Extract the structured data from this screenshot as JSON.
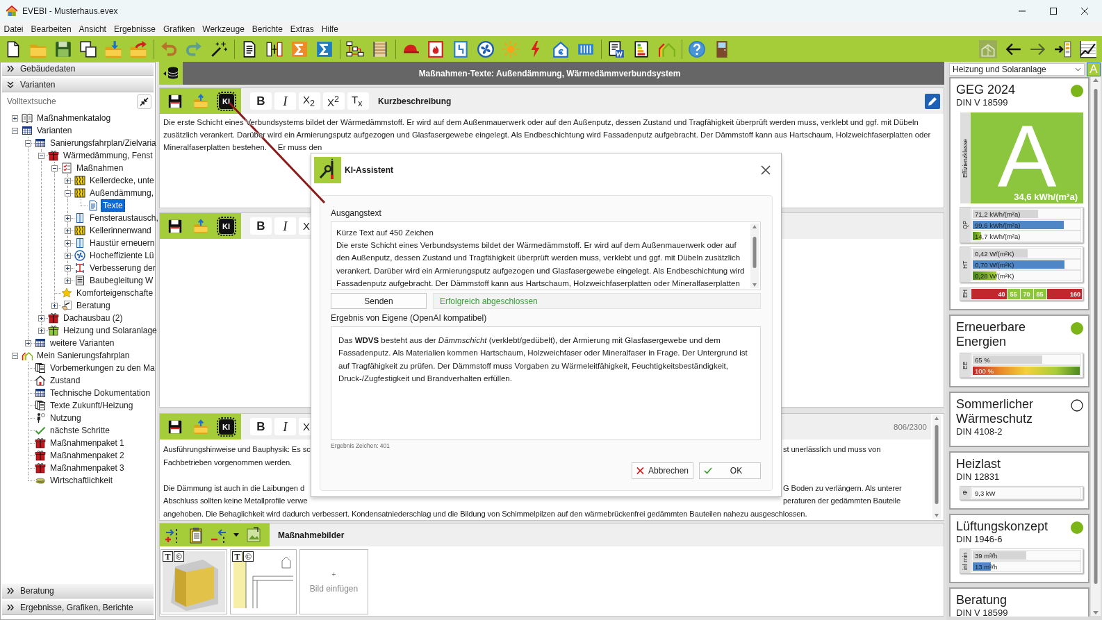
{
  "window": {
    "title": "EVEBI - Musterhaus.evex"
  },
  "menu": [
    "Datei",
    "Bearbeiten",
    "Ansicht",
    "Ergebnisse",
    "Grafiken",
    "Werkzeuge",
    "Berichte",
    "Extras",
    "Hilfe"
  ],
  "sidebar": {
    "sections_top": [
      {
        "label": "Gebäudedaten",
        "expanded": false
      },
      {
        "label": "Varianten",
        "expanded": true
      }
    ],
    "search": {
      "placeholder": "Volltextsuche"
    },
    "tree": [
      {
        "label": "Maßnahmenkatalog",
        "kind": "catalog",
        "expanded": false,
        "selected": false
      },
      {
        "label": "Varianten",
        "kind": "table",
        "expanded": true,
        "selected": false,
        "children": [
          {
            "label": "Sanierungsfahrplan/Zielvaria",
            "kind": "table",
            "expanded": true,
            "selected": false,
            "children": [
              {
                "label": "Wärmedämmung, Fenst",
                "kind": "package",
                "color": "#c8141c",
                "expanded": true,
                "selected": false,
                "children": [
                  {
                    "label": "Maßnahmen",
                    "kind": "measures",
                    "expanded": true,
                    "selected": false,
                    "children": [
                      {
                        "label": "Kellerdecke, unte",
                        "kind": "insulation",
                        "expanded": false,
                        "selected": false
                      },
                      {
                        "label": "Außendämmung,",
                        "kind": "insulation",
                        "expanded": true,
                        "selected": false,
                        "children": [
                          {
                            "label": "Texte",
                            "kind": "text",
                            "selected": true
                          }
                        ]
                      },
                      {
                        "label": "Fensteraustausch,",
                        "kind": "window",
                        "expanded": false,
                        "selected": false
                      },
                      {
                        "label": "Kellerinnenwand",
                        "kind": "insulation",
                        "expanded": false,
                        "selected": false
                      },
                      {
                        "label": "Haustür erneuern",
                        "kind": "window",
                        "expanded": false,
                        "selected": false
                      },
                      {
                        "label": "Hocheffiziente Lü",
                        "kind": "ventilation",
                        "expanded": false,
                        "selected": false
                      },
                      {
                        "label": "Verbesserung der",
                        "kind": "piping",
                        "expanded": false,
                        "selected": false
                      },
                      {
                        "label": "Baubegleitung W",
                        "kind": "supervision",
                        "expanded": false,
                        "selected": false
                      }
                    ]
                  },
                  {
                    "label": "Komforteigenschafte",
                    "kind": "comfort",
                    "selected": false
                  },
                  {
                    "label": "Beratung",
                    "kind": "consulting",
                    "expanded": false,
                    "selected": false
                  }
                ]
              },
              {
                "label": "Dachausbau (2)",
                "kind": "package",
                "color": "#c8141c",
                "expanded": false,
                "selected": false
              },
              {
                "label": "Heizung und Solaranlage",
                "kind": "package",
                "color": "#8dc63f",
                "expanded": false,
                "selected": false
              }
            ]
          },
          {
            "label": "weitere Varianten",
            "kind": "table",
            "expanded": false,
            "selected": false
          }
        ]
      },
      {
        "label": "Mein Sanierungsfahrplan",
        "kind": "plan",
        "expanded": true,
        "selected": false,
        "children": [
          {
            "label": "Vorbemerkungen zu den Ma",
            "kind": "pages",
            "selected": false
          },
          {
            "label": "Zustand",
            "kind": "house",
            "selected": false
          },
          {
            "label": "Technische Dokumentation",
            "kind": "table",
            "selected": false
          },
          {
            "label": "Texte Zukunft/Heizung",
            "kind": "pages",
            "selected": false
          },
          {
            "label": "Nutzung",
            "kind": "usage",
            "selected": false
          },
          {
            "label": "nächste Schritte",
            "kind": "steps",
            "selected": false
          },
          {
            "label": "Maßnahmenpaket 1",
            "kind": "package",
            "color": "#c8141c",
            "selected": false
          },
          {
            "label": "Maßnahmenpaket 2",
            "kind": "package",
            "color": "#c8141c",
            "selected": false
          },
          {
            "label": "Maßnahmenpaket 3",
            "kind": "package",
            "color": "#c8141c",
            "selected": false
          },
          {
            "label": "Wirtschaftlichkeit",
            "kind": "economics",
            "selected": false
          }
        ]
      }
    ],
    "sections_bottom": [
      {
        "label": "Beratung",
        "expanded": false
      },
      {
        "label": "Ergebnisse, Grafiken, Berichte",
        "expanded": false
      }
    ]
  },
  "content": {
    "title": "Maßnahmen-Texte: Außendämmung, Wärmedämmverbundsystem",
    "editors": [
      {
        "ki_label": "KI",
        "format_buttons": [
          {
            "label": "B",
            "kind": "bold"
          },
          {
            "label": "I",
            "kind": "italic"
          },
          {
            "label": "X$_{2}$",
            "kind": "subscript"
          },
          {
            "label": "X$^{2}$",
            "kind": "superscript"
          },
          {
            "label": "T$_{x}$",
            "kind": "clear"
          }
        ],
        "label": "Kurzbeschreibung",
        "lines": [
          {
            "text": "Die erste Schicht eines Verbundsystems bildet der Wärmedämmstoff. Er wird auf dem Außenmauerwerk oder auf den Außenputz, dessen Zustand und Tragfähigkeit überprüft werden muss, verklebt und ggf. mit Dübeln"
          },
          {
            "text": "zusätzlich verankert. Darüber wird ein Armierungsputz aufgezogen und Glasfasergewebe eingelegt. Als Endbeschichtung wird Fassadenputz aufgebracht. Der Dämmstoff kann aus Hartschaum, Holzweichfaserplatten oder"
          },
          {
            "text": "Mineralfaserplatten bestehen.",
            "tail": "Er muss den"
          }
        ]
      },
      {
        "ki_label": "KI",
        "format_buttons": [
          {
            "label": "B",
            "kind": "bold"
          },
          {
            "label": "I",
            "kind": "italic"
          },
          {
            "label": "X",
            "kind": "subscript"
          }
        ]
      },
      {
        "ki_label": "KI",
        "format_buttons": [
          {
            "label": "B",
            "kind": "bold"
          },
          {
            "label": "I",
            "kind": "italic"
          },
          {
            "label": "X",
            "kind": "subscript"
          }
        ],
        "counter": "806/2300",
        "paragraphs": [
          {
            "lines": [
              {
                "left": "Ausführungshinweise und Bauphysik: Es sc",
                "right": "st unerlässlich und muss von"
              },
              {
                "left": "Fachbetrieben vorgenommen werden."
              }
            ]
          },
          {
            "lines": [
              {
                "left": "Die Dämmung ist auch in die Laibungen d",
                "right": "G Boden zu verlängern. Als unterer"
              },
              {
                "left": "Abschluss sollten keine Metallprofile verwe",
                "right": "peraturen der gedämmten Bauteile"
              },
              {
                "left": "angehoben. Die Behaglichkeit wird dadurch verbessert. Kondensatniederschlag und die Bildung von Schimmelpilzen auf den wärmebrückenfrei gedämmten Bauteilen nahezu ausgeschlossen."
              }
            ]
          }
        ]
      }
    ],
    "images": {
      "label": "Maßnahmebilder",
      "thumbnails": [
        {
          "kind": "photo",
          "badges": [
            "T",
            "©"
          ]
        },
        {
          "kind": "drawing",
          "badges": [
            "T",
            "©"
          ]
        }
      ],
      "add_tile": {
        "plus": "+",
        "label": "Bild einfügen"
      }
    }
  },
  "dialog": {
    "title": "KI-Assistent",
    "source_label": "Ausgangstext",
    "source_text": "Kürze Text auf 450 Zeichen\nDie erste Schicht eines Verbundsystems bildet der Wärmedämmstoff. Er wird auf dem Außenmauerwerk oder auf den Außenputz, dessen Zustand und Tragfähigkeit überprüft werden muss, verklebt und ggf. mit Dübeln zusätzlich verankert. Darüber wird ein Armierungsputz aufgezogen und Glasfasergewebe eingelegt. Als Endbeschichtung wird Fassadenputz aufgebracht. Der Dämmstoff kann aus Hartschaum, Holzweichfaserplatten oder Mineralfaserplatten",
    "send_button": "Senden",
    "status": "Erfolgreich abgeschlossen",
    "succeeded": true,
    "result_label": "Ergebnis von Eigene (OpenAI kompatibel)",
    "result_text": "Das **WDVS** besteht aus der *Dämmschicht* (verklebt/gedübelt), der Armierung mit Glasfasergewebe und dem Fassadenputz. Als Materialien kommen Hartschaum, Holzweichfaser oder Mineralfaser in Frage. Der Untergrund ist auf Tragfähigkeit zu prüfen. Der Dämmstoff muss Vorgaben zu Wärmeleitfähigkeit, Feuchtigkeitsbeständigkeit, Druck-/Zugfestigkeit und Brandverhalten erfüllen.",
    "result_count": "Ergebnis Zeichen: 401",
    "buttons": [
      {
        "label": "Abbrechen",
        "kind": "cancel"
      },
      {
        "label": "OK",
        "kind": "confirm"
      }
    ]
  },
  "right_panel": {
    "variant_select": "Heizung und Solaranlage",
    "class_button": "A",
    "cards": [
      {
        "title": "GEG 2024",
        "subtitle": "DIN V 18599",
        "fulfilled": true,
        "efficiency": {
          "axis": "Effizienzklasse",
          "letter": "A",
          "value": "34,6 kWh/(m²a)"
        },
        "groups": [
          {
            "axis": "QP",
            "bars": [
              {
                "text": "71,2 kWh/(m²a)",
                "kind": "reference",
                "level": 0.61
              },
              {
                "text": "99,6 kWh/(m²a)",
                "kind": "requirement",
                "level": 0.85
              },
              {
                "text": "14,7 kWh/(m²a)",
                "kind": "result",
                "level": 0.08
              }
            ]
          },
          {
            "axis": "HT",
            "bars": [
              {
                "text": "0,42 W/(m²K)",
                "kind": "reference",
                "level": 0.51
              },
              {
                "text": "0,70 W/(m²K)",
                "kind": "requirement",
                "level": 0.86
              },
              {
                "text": "0,28 W/(m²K)",
                "kind": "result",
                "level": 0.22
              }
            ]
          }
        ],
        "scale": {
          "axis": "EH",
          "segments": [
            {
              "label": "40",
              "color": "#c0282d"
            },
            {
              "label": "55",
              "color": "#8cc63f"
            },
            {
              "label": "70",
              "color": "#8cc63f"
            },
            {
              "label": "85",
              "color": "#8cc63f"
            },
            {
              "label": "160",
              "color": "#c0282d"
            }
          ]
        }
      },
      {
        "title": "Erneuerbare Energien",
        "fulfilled": true,
        "groups": [
          {
            "axis": "EE",
            "bars": [
              {
                "text": "65 %",
                "kind": "reference",
                "level": 0.65
              },
              {
                "text": "100 %",
                "kind": "rating",
                "level": 1
              }
            ]
          }
        ]
      },
      {
        "title": "Sommerlicher Wärmeschutz",
        "subtitle": "DIN 4108-2",
        "fulfilled": false
      },
      {
        "title": "Heizlast",
        "subtitle": "DIN 12831",
        "groups": [
          {
            "axis": "Φ",
            "bars": [
              {
                "text": "9,3 kW"
              }
            ]
          }
        ]
      },
      {
        "title": "Lüftungskonzept",
        "subtitle": "DIN 1946-6",
        "fulfilled": true,
        "groups": [
          {
            "axis": "inf min",
            "bars": [
              {
                "text": "39 m³/h",
                "kind": "reference",
                "level": 0.5
              },
              {
                "text": "13 m³/h",
                "kind": "requirement",
                "level": 0.17
              }
            ]
          }
        ]
      },
      {
        "title": "Beratung",
        "subtitle": "DIN V 18599"
      }
    ]
  }
}
